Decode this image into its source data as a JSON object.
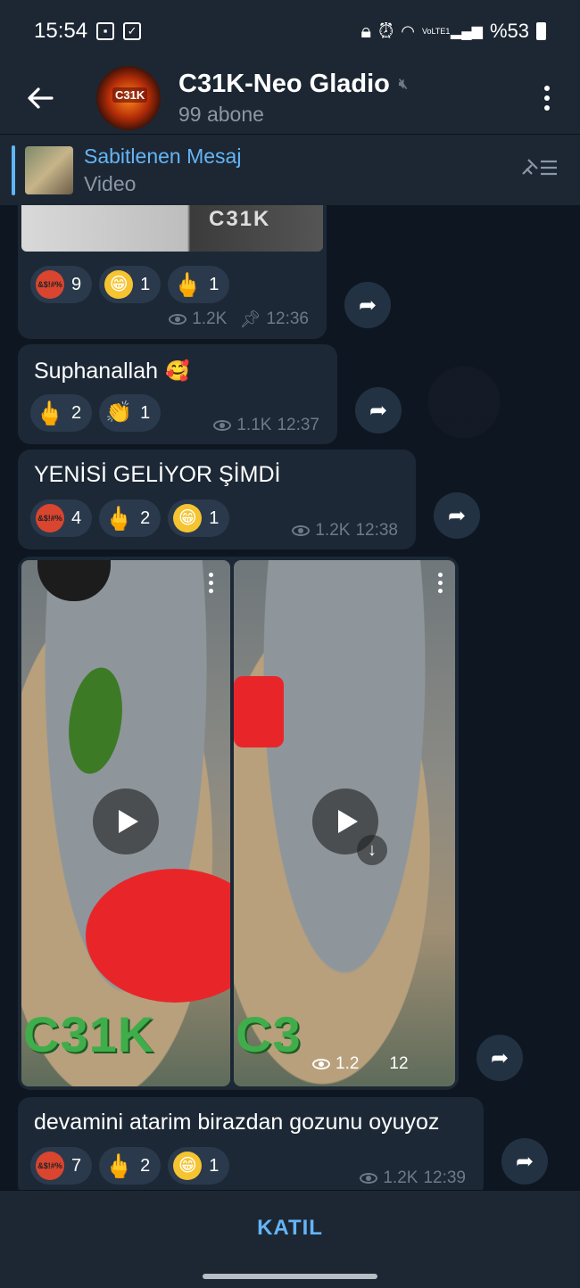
{
  "status_bar": {
    "time": "15:54",
    "left_icons": [
      "image-icon",
      "check-icon"
    ],
    "right_icons": [
      "lock-icon",
      "alarm-icon",
      "wifi-icon",
      "volte-icon",
      "signal-icon",
      "battery-icon"
    ],
    "volte_label": "VoLTE1",
    "battery": "%53"
  },
  "header": {
    "title": "C31K-Neo Gladio",
    "avatar_label": "C31K",
    "subscribers": "99 abone"
  },
  "pinned": {
    "title": "Sabitlenen Mesaj",
    "subtitle": "Video"
  },
  "messages": [
    {
      "top_media_text": "C31K",
      "reactions": [
        {
          "emoji": "angry-swearing",
          "label": "&$!#%",
          "count": "9"
        },
        {
          "emoji": "grin",
          "count": "1"
        },
        {
          "emoji": "middle-finger",
          "count": "1"
        }
      ],
      "views": "1.2K",
      "time": "12:36",
      "edited_icon": "pin-icon"
    },
    {
      "text": "Suphanallah",
      "text_emoji": "🥰",
      "reactions": [
        {
          "emoji": "middle-finger",
          "count": "2"
        },
        {
          "emoji": "clap",
          "count": "1"
        }
      ],
      "views": "1.1K",
      "time": "12:37"
    },
    {
      "text": "YENİSİ GELİYOR ŞİMDİ",
      "reactions": [
        {
          "emoji": "angry-swearing",
          "label": "&$!#%",
          "count": "4"
        },
        {
          "emoji": "middle-finger",
          "count": "2"
        },
        {
          "emoji": "grin",
          "count": "1"
        }
      ],
      "views": "1.2K",
      "time": "12:38"
    },
    {
      "album": {
        "logo_text_1": "C31K",
        "logo_text_2": "C3",
        "views": "1.2",
        "time": "12"
      }
    },
    {
      "text": "devamini atarim birazdan gozunu oyuyoz",
      "reactions": [
        {
          "emoji": "angry-swearing",
          "label": "&$!#%",
          "count": "7"
        },
        {
          "emoji": "middle-finger",
          "count": "2"
        },
        {
          "emoji": "grin",
          "count": "1"
        }
      ],
      "views": "1.2K",
      "time": "12:39"
    }
  ],
  "bottom": {
    "join_label": "KATIL"
  },
  "colors": {
    "background": "#0e1621",
    "bar": "#1d2733",
    "bubble": "#1c2836",
    "accent": "#64b5f6"
  }
}
